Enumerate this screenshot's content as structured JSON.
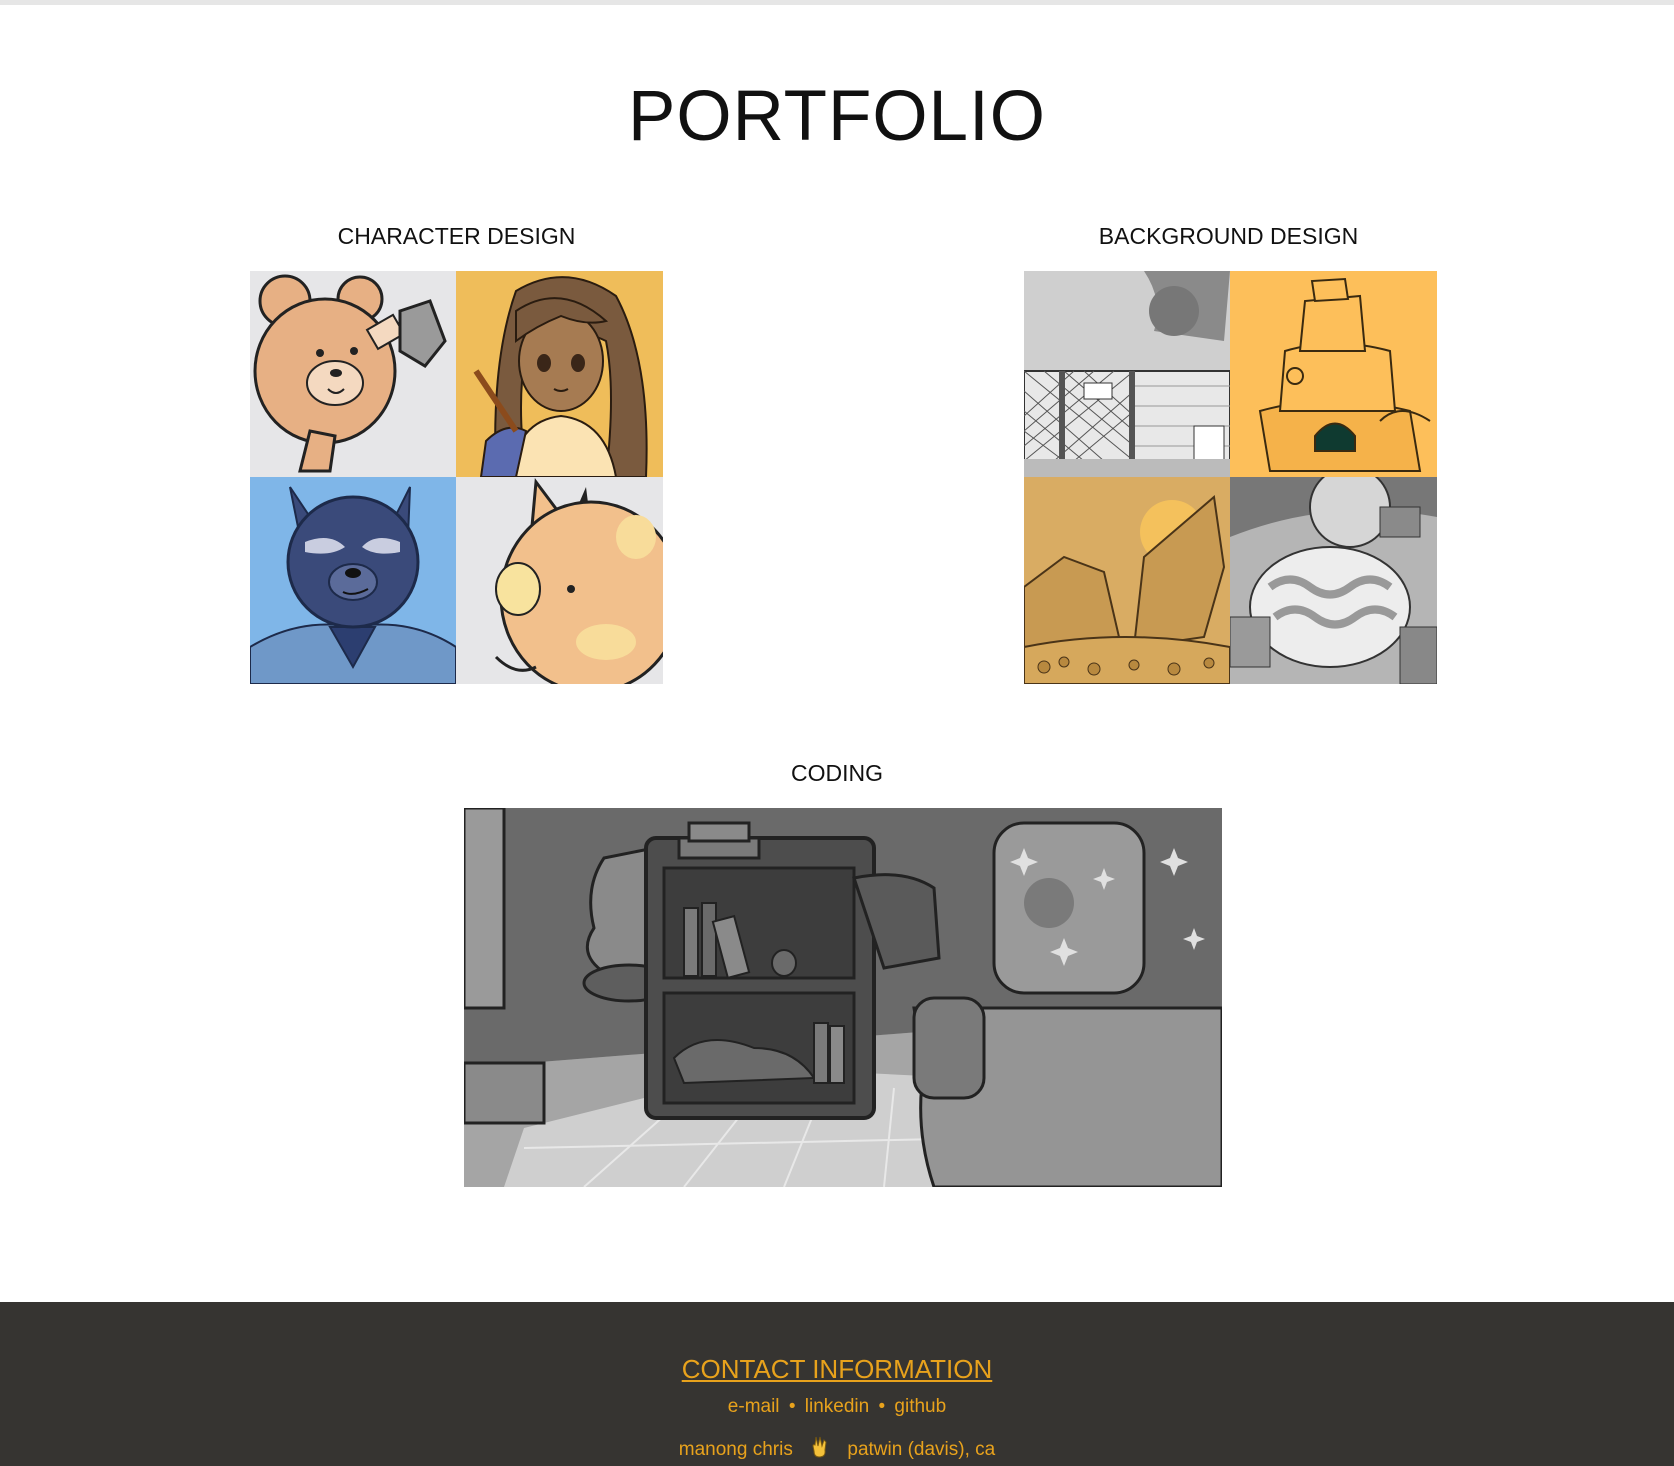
{
  "page": {
    "title": "PORTFOLIO"
  },
  "sections": {
    "character_design": {
      "title": "CHARACTER DESIGN"
    },
    "background_design": {
      "title": "BACKGROUND DESIGN"
    },
    "coding": {
      "title": "CODING"
    }
  },
  "footer": {
    "heading": "CONTACT INFORMATION",
    "links": [
      "e-mail",
      "linkedin",
      "github"
    ],
    "separator": "•",
    "signature_left": "manong chris",
    "signature_icon": "victory-hand-icon",
    "signature_right": "patwin (davis), ca"
  },
  "colors": {
    "accent": "#e8a21c",
    "footer_bg": "#363431",
    "tile_yellow": "#f0bb55",
    "tile_blue": "#7fb6e8",
    "tile_gray": "#e6e6e8"
  }
}
